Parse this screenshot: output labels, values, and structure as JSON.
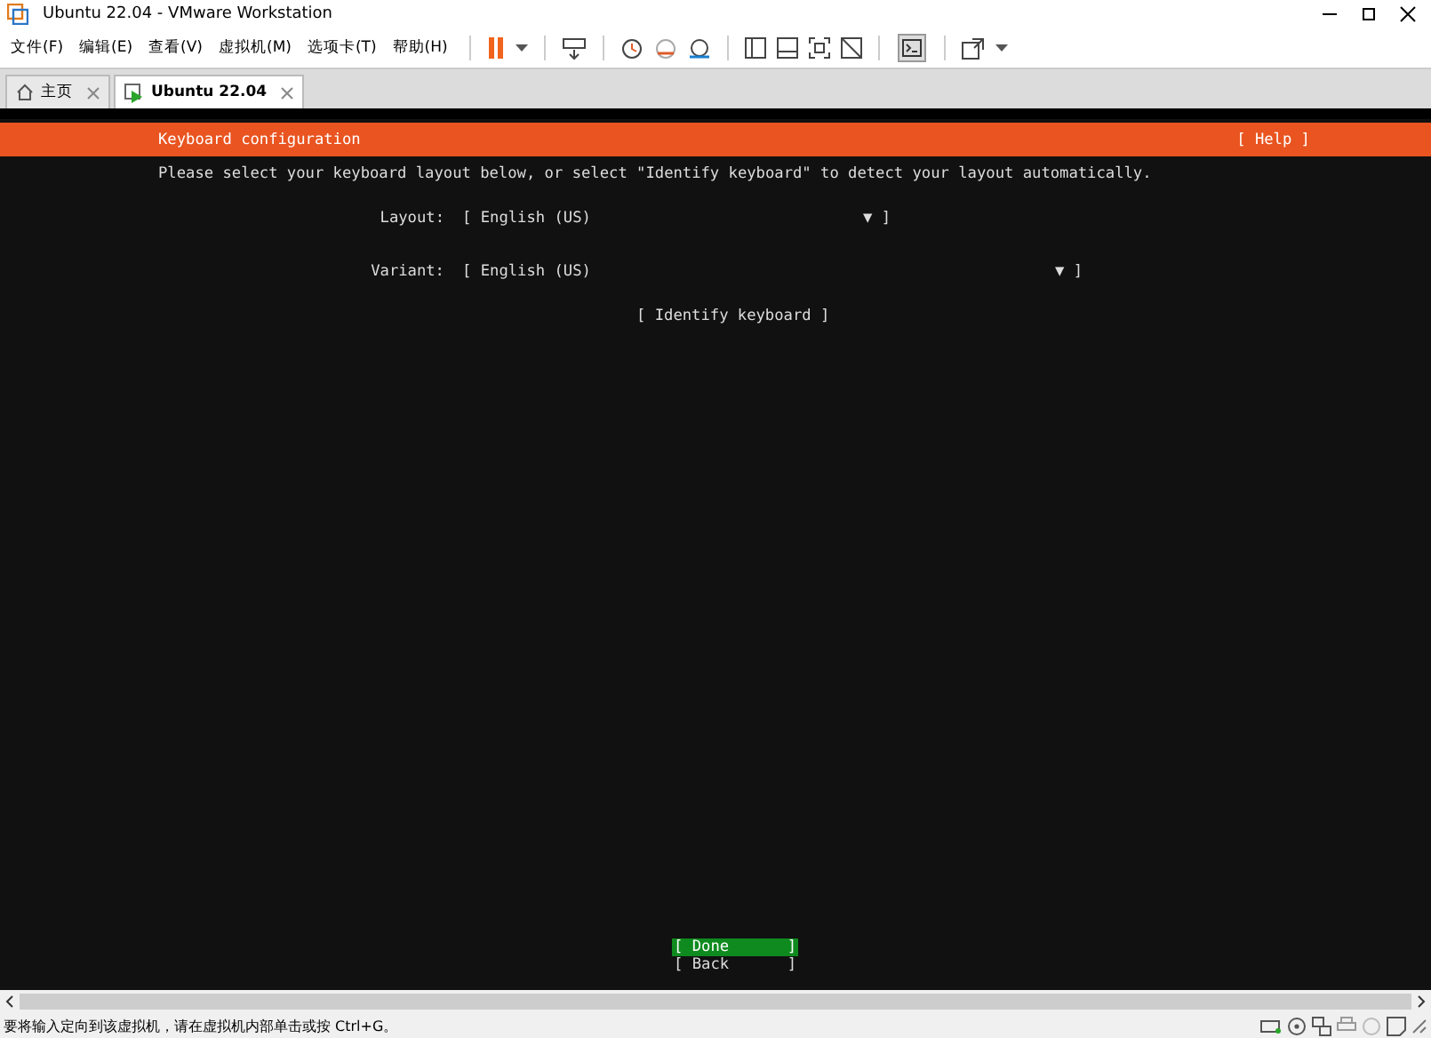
{
  "window": {
    "title": "Ubuntu 22.04 - VMware Workstation"
  },
  "menu": [
    "文件(F)",
    "编辑(E)",
    "查看(V)",
    "虚拟机(M)",
    "选项卡(T)",
    "帮助(H)"
  ],
  "tabs": [
    {
      "label": "主页",
      "kind": "home",
      "selected": false
    },
    {
      "label": "Ubuntu 22.04",
      "kind": "vm",
      "selected": true
    }
  ],
  "installer": {
    "title": "Keyboard configuration",
    "help": "[ Help ]",
    "instructions": "Please select your keyboard layout below, or select \"Identify keyboard\" to detect your layout automatically.",
    "fields": [
      {
        "label": "Layout:",
        "value": "[ English (US)",
        "end": "▼ ]",
        "kind": "short"
      },
      {
        "label": "Variant:",
        "value": "[ English (US)",
        "end": "▼ ]",
        "kind": "long"
      }
    ],
    "identify": "[ Identify keyboard ]",
    "buttons": [
      {
        "label": "[ Done",
        "end": "]",
        "selected": true
      },
      {
        "label": "[ Back",
        "end": "]",
        "selected": false
      }
    ]
  },
  "status_bar": {
    "message": "要将输入定向到该虚拟机，请在虚拟机内部单击或按 Ctrl+G。"
  }
}
